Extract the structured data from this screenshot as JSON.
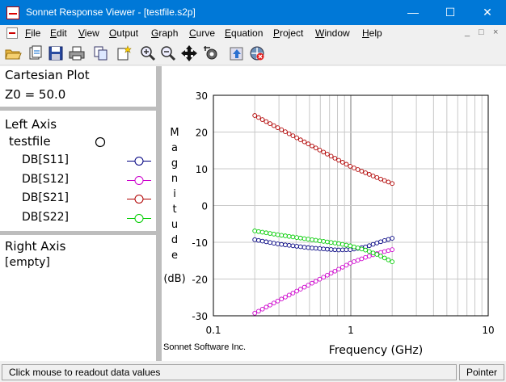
{
  "window": {
    "title": "Sonnet Response Viewer - [testfile.s2p]",
    "minimize": "—",
    "maximize": "☐",
    "close": "✕"
  },
  "menu": {
    "items": [
      "File",
      "Edit",
      "View",
      "Output",
      "Graph",
      "Curve",
      "Equation",
      "Project",
      "Window",
      "Help"
    ],
    "mdi": [
      "_",
      "□",
      "×"
    ]
  },
  "toolbar": {
    "icons": [
      "open-folder-icon",
      "open-file-icon",
      "save-icon",
      "print-icon",
      "copy-icon",
      "new-icon",
      "zoom-in-icon",
      "zoom-out-icon",
      "pan-icon",
      "settings-icon",
      "up-icon",
      "freeze-icon"
    ]
  },
  "left_panel": {
    "plot_type": "Cartesian Plot",
    "z0": "Z0 = 50.0",
    "left_axis_title": "Left Axis",
    "file_name": "testfile",
    "curves": [
      {
        "label": "DB[S11]",
        "color": "#000080"
      },
      {
        "label": "DB[S12]",
        "color": "#cc00cc"
      },
      {
        "label": "DB[S21]",
        "color": "#b00000"
      },
      {
        "label": "DB[S22]",
        "color": "#00cc00"
      }
    ],
    "right_axis_title": "Right Axis",
    "right_axis_value": "[empty]"
  },
  "plot": {
    "credit": "Sonnet Software Inc."
  },
  "chart_data": {
    "type": "line",
    "title": "",
    "xlabel": "Frequency (GHz)",
    "ylabel": "Magnitude (dB)",
    "x_scale": "log",
    "xlim": [
      0.1,
      10
    ],
    "ylim": [
      -30,
      30
    ],
    "x_ticks": [
      "0.1",
      "1",
      "10"
    ],
    "y_ticks": [
      "30",
      "20",
      "10",
      "0",
      "-10",
      "-20",
      "-30"
    ],
    "grid": true,
    "freq_start": 0.2,
    "freq_stop": 2.0,
    "num_points": 37,
    "series": [
      {
        "name": "DB[S11]",
        "color": "#000080",
        "x": [
          0.2,
          0.3,
          0.5,
          0.8,
          1.0,
          1.3,
          1.6,
          2.0
        ],
        "y": [
          -9.3,
          -10.5,
          -11.5,
          -12.1,
          -12.0,
          -11.2,
          -10.0,
          -8.9
        ]
      },
      {
        "name": "DB[S12]",
        "color": "#cc00cc",
        "x": [
          0.2,
          0.3,
          0.5,
          0.8,
          1.0,
          1.3,
          1.6,
          2.0
        ],
        "y": [
          -29.3,
          -25.8,
          -21.5,
          -17.5,
          -15.6,
          -14.0,
          -12.9,
          -12.0
        ]
      },
      {
        "name": "DB[S21]",
        "color": "#b00000",
        "x": [
          0.2,
          0.3,
          0.5,
          0.8,
          1.0,
          1.3,
          1.6,
          2.0
        ],
        "y": [
          24.5,
          21.0,
          16.6,
          12.5,
          10.6,
          8.8,
          7.4,
          6.0
        ]
      },
      {
        "name": "DB[S22]",
        "color": "#00cc00",
        "x": [
          0.2,
          0.3,
          0.5,
          0.8,
          1.0,
          1.3,
          1.6,
          2.0
        ],
        "y": [
          -6.9,
          -8.0,
          -9.2,
          -10.3,
          -11.0,
          -12.2,
          -13.5,
          -15.3
        ]
      }
    ]
  },
  "status": {
    "message": "Click mouse to readout data values",
    "mode": "Pointer"
  }
}
